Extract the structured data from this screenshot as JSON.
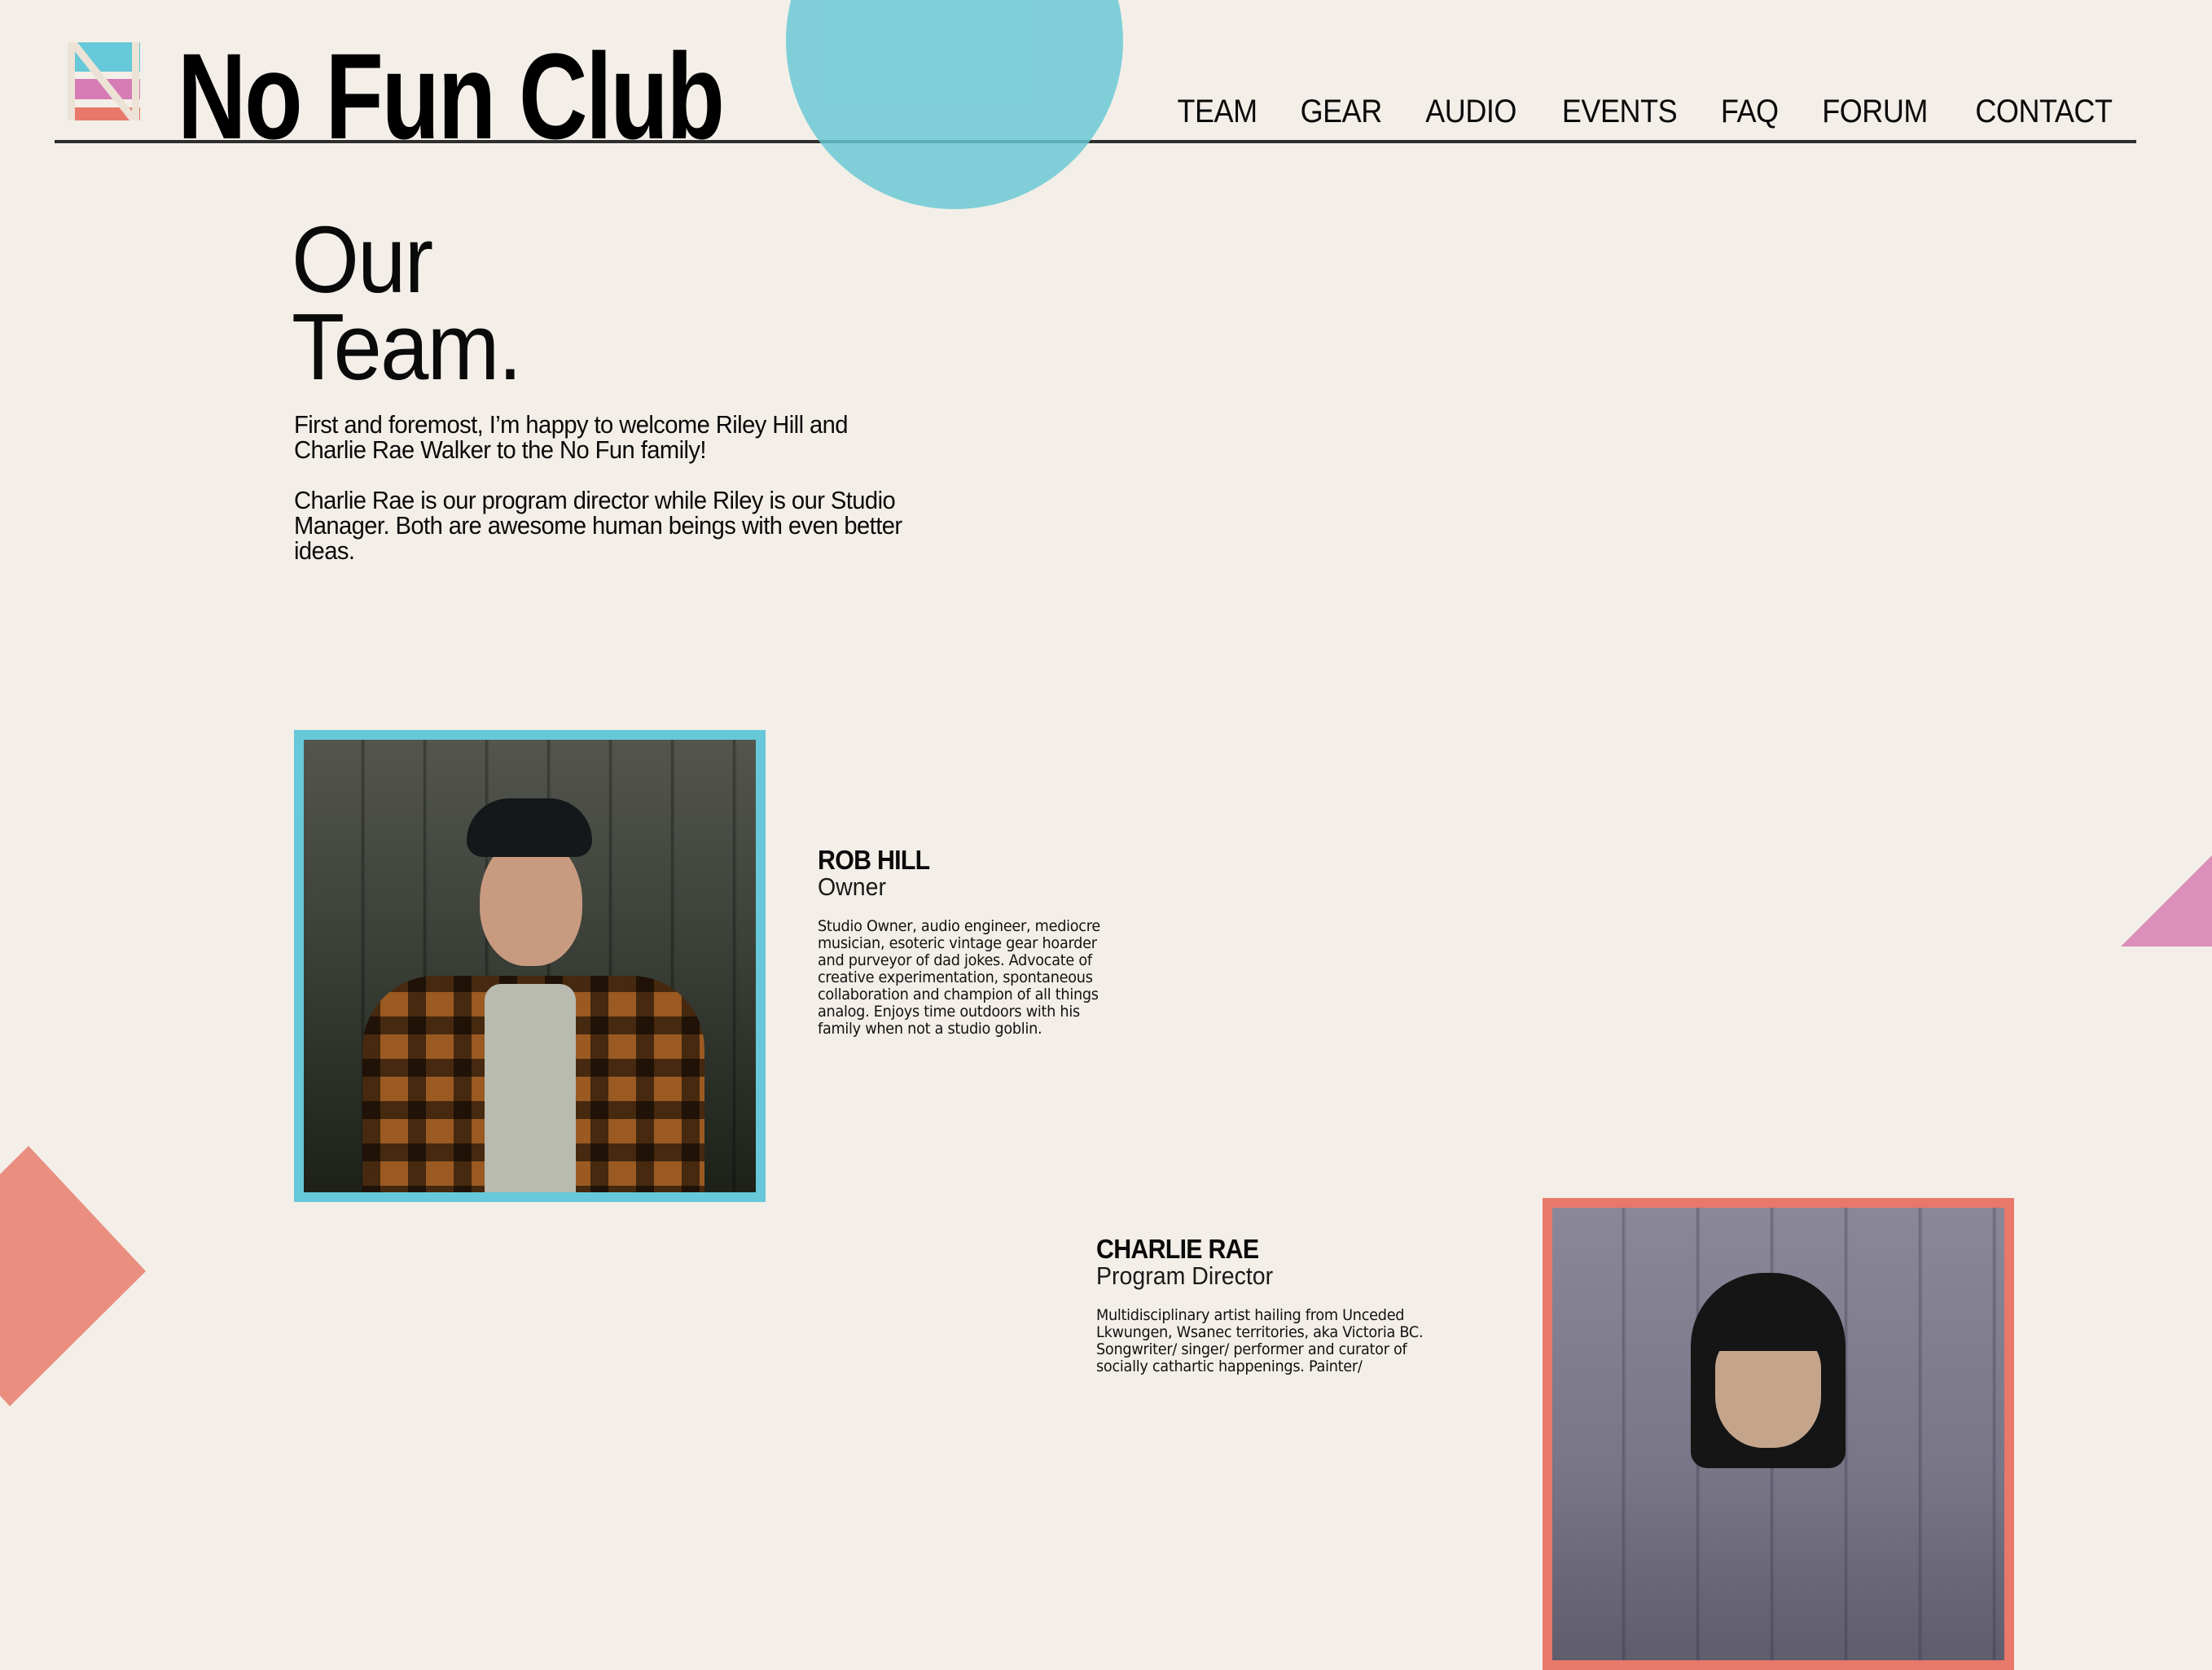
{
  "site": {
    "name": "No Fun Club",
    "logo_icon": "nfc-striped-n-logo-icon"
  },
  "nav": {
    "items": [
      {
        "label": "TEAM"
      },
      {
        "label": "GEAR"
      },
      {
        "label": "AUDIO"
      },
      {
        "label": "EVENTS"
      },
      {
        "label": "FAQ"
      },
      {
        "label": "FORUM"
      },
      {
        "label": "CONTACT"
      }
    ]
  },
  "page": {
    "title_line1": "Our",
    "title_line2": "Team.",
    "intro": [
      "First and foremost, I’m happy to welcome Riley Hill and Charlie Rae Walker to the No Fun family!",
      "Charlie Rae is our program director while Riley is our Studio Manager. Both are awesome human beings with even better ideas."
    ]
  },
  "team": [
    {
      "name": "ROB HILL",
      "role": "Owner",
      "photo_alt": "Portrait of Rob Hill in a beanie and plaid flannel shirt against a wood wall",
      "bio_lines": [
        "Studio Owner, audio engineer, mediocre",
        "musician, esoteric vintage gear hoarder",
        "and purveyor of dad jokes. Advocate of",
        "creative experimentation, spontaneous",
        "collaboration and champion of all things",
        "analog. Enjoys time outdoors with his",
        "family when not a studio goblin."
      ]
    },
    {
      "name": "CHARLIE RAE",
      "role": "Program Director",
      "photo_alt": "Portrait of Charlie Rae with dark hair and bangs against a wood wall",
      "bio_lines": [
        "Multidisciplinary artist hailing from Unceded",
        "Lkwungen, Wsanec territories, aka Victoria BC.",
        "Songwriter/ singer/ performer and curator of",
        "socially cathartic happenings. Painter/"
      ]
    }
  ],
  "colors": {
    "background": "#f3efe8",
    "cyan": "#66c8d8",
    "pink": "#da90b8",
    "coral": "#e8786a",
    "text": "#0a0a0a",
    "rule": "#2e2e2e"
  }
}
